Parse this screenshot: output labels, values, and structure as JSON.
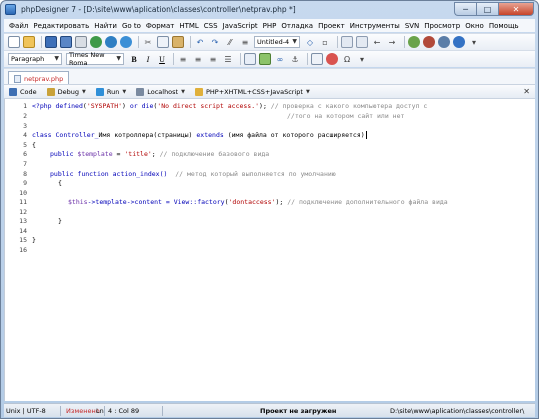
{
  "window": {
    "title": "phpDesigner 7 - [D:\\site\\www\\aplication\\classes\\controller\\netprav.php *]",
    "caption_min": "─",
    "caption_max": "□",
    "caption_close": "✕"
  },
  "menu": [
    "Файл",
    "Редактировать",
    "Найти",
    "Go to",
    "Формат",
    "HTML",
    "CSS",
    "JavaScript",
    "PHP",
    "Отладка",
    "Проект",
    "Инструменты",
    "SVN",
    "Просмотр",
    "Окно",
    "Помощь"
  ],
  "toolbar": {
    "encoding": "Untitled-4"
  },
  "format_bar": {
    "paragraph": "Paragraph",
    "font": "Times New Roma",
    "bold": "B",
    "italic": "I",
    "underline": "U"
  },
  "tab": {
    "label": "netprav.php"
  },
  "mode_bar": {
    "code": "Code",
    "debug": "Debug",
    "run": "Run",
    "localhost": "Localhost",
    "syntax": "PHP+XHTML+CSS+JavaScript",
    "close": "✕"
  },
  "editor": {
    "line_numbers": [
      "1",
      "2",
      "3",
      "4",
      "5",
      "6",
      "7",
      "8",
      "9",
      "10",
      "11",
      "12",
      "13",
      "14",
      "15",
      "16"
    ],
    "lines": {
      "l1": {
        "a": "<?php ",
        "b": "defined",
        "c": "(",
        "d": "'SYSPATH'",
        "e": ") ",
        "f": "or",
        "g": " ",
        "h": "die",
        "i": "(",
        "j": "'No direct script access.'",
        "k": "); ",
        "l": "// проверка с какого компьютера доступ с"
      },
      "l2": {
        "cm": "//того на котором сайт или нет"
      },
      "l4": {
        "a": "class",
        "b": " Controller_",
        "c": "Имя котроллера(страницы)",
        "d": " extends ",
        "e": "(имя файла от которого расширяется)"
      },
      "l5": {
        "a": "{"
      },
      "l6": {
        "a": "public",
        "b": " ",
        "c": "$template",
        "d": " = ",
        "e": "'title'",
        "f": "; ",
        "g": "// подключение базового вида"
      },
      "l8": {
        "a": "public",
        "b": " ",
        "c": "function",
        "d": " action_index()  ",
        "e": "// метод который выполняется по умолчанию"
      },
      "l9": {
        "a": "{"
      },
      "l11": {
        "a": "$this",
        "b": "->template->",
        "c": "content",
        "d": " = View::",
        "e": "factory",
        "f": "(",
        "g": "'dontaccess'",
        "h": "); ",
        "i": "// подключение дополнительного файла вида"
      },
      "l13": {
        "a": "}"
      },
      "l15": {
        "a": "}"
      }
    }
  },
  "status": {
    "encoding": "Unix | UTF-8",
    "modified": "Изменено",
    "ln": "Ln",
    "position": "4 : Col  89",
    "project": "Проект не загружен",
    "path": "D:\\site\\www\\aplication\\classes\\controller\\"
  },
  "colors": {
    "keyword": "#0000b8",
    "string": "#b00000",
    "variable": "#6a2fa8",
    "comment": "#8a8a8a",
    "modified": "#c62828"
  }
}
